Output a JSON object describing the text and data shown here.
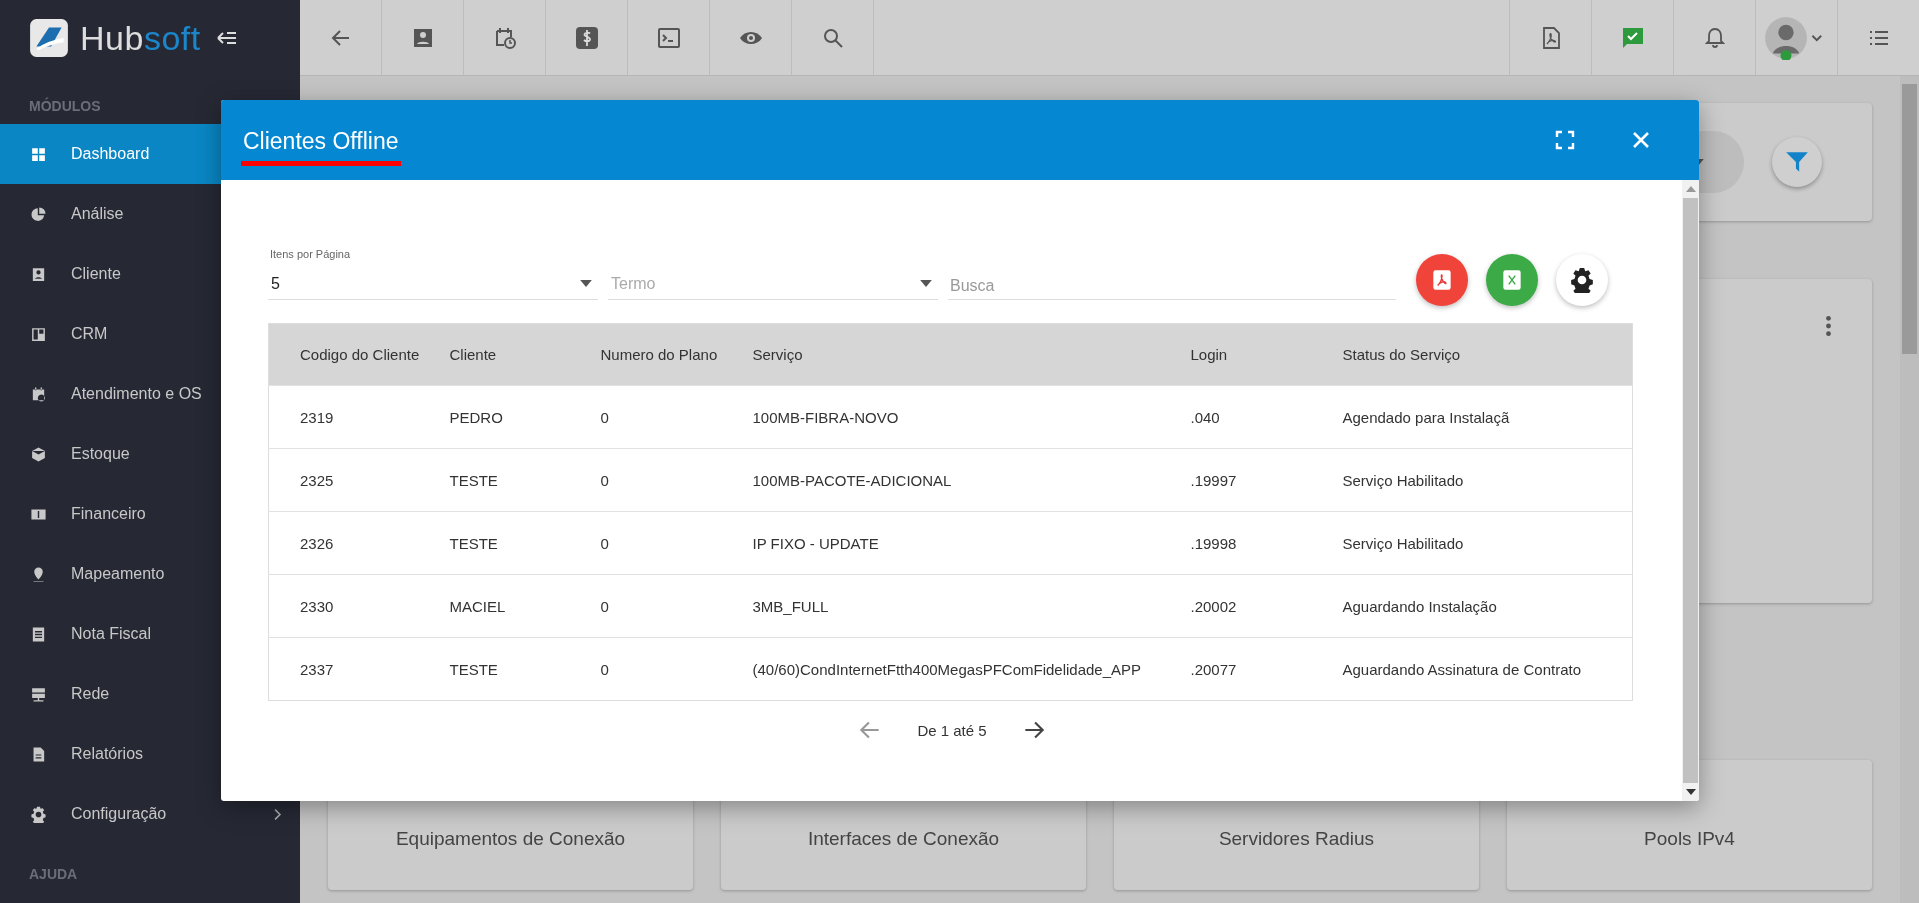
{
  "logo": {
    "part_1": "Hub",
    "part_2": "soft"
  },
  "sidebar": {
    "section": "MÓDULOS",
    "items": [
      {
        "label": "Dashboard",
        "selected": true
      },
      {
        "label": "Análise",
        "selected": false
      },
      {
        "label": "Cliente",
        "selected": false
      },
      {
        "label": "CRM",
        "selected": false
      },
      {
        "label": "Atendimento e OS",
        "selected": false
      },
      {
        "label": "Estoque",
        "selected": false
      },
      {
        "label": "Financeiro",
        "selected": false
      },
      {
        "label": "Mapeamento",
        "selected": false
      },
      {
        "label": "Nota Fiscal",
        "selected": false
      },
      {
        "label": "Rede",
        "selected": false
      },
      {
        "label": "Relatórios",
        "selected": false
      },
      {
        "label": "Configuração",
        "selected": false,
        "expandable": true
      }
    ],
    "footer_section": "AJUDA"
  },
  "stat_cards": [
    {
      "label": "Equipamentos de Conexão"
    },
    {
      "label": "Interfaces de Conexão"
    },
    {
      "label": "Servidores Radius"
    },
    {
      "label": "Pools IPv4"
    }
  ],
  "modal": {
    "title": "Clientes Offline",
    "items_per_page": {
      "label": "Itens por Página",
      "value": "5"
    },
    "term": {
      "placeholder": "Termo"
    },
    "search": {
      "placeholder": "Busca"
    },
    "columns": [
      "Codigo do Cliente",
      "Cliente",
      "Numero do Plano",
      "Serviço",
      "Login",
      "Status do Serviço"
    ],
    "rows": [
      [
        "2319",
        "PEDRO",
        "0",
        "100MB-FIBRA-NOVO",
        ".040",
        "Agendado para Instalaçã"
      ],
      [
        "2325",
        "TESTE",
        "0",
        "100MB-PACOTE-ADICIONAL",
        ".19997",
        "Serviço Habilitado"
      ],
      [
        "2326",
        "TESTE",
        "0",
        "IP FIXO - UPDATE",
        ".19998",
        "Serviço Habilitado"
      ],
      [
        "2330",
        "MACIEL",
        "0",
        "3MB_FULL",
        ".20002",
        "Aguardando Instalação"
      ],
      [
        "2337",
        "TESTE",
        "0",
        "(40/60)CondInternetFtth400MegasPFComFidelidade_APP",
        ".20077",
        "Aguardando Assinatura de Contrato"
      ]
    ],
    "pagination": "De 1 até 5"
  }
}
